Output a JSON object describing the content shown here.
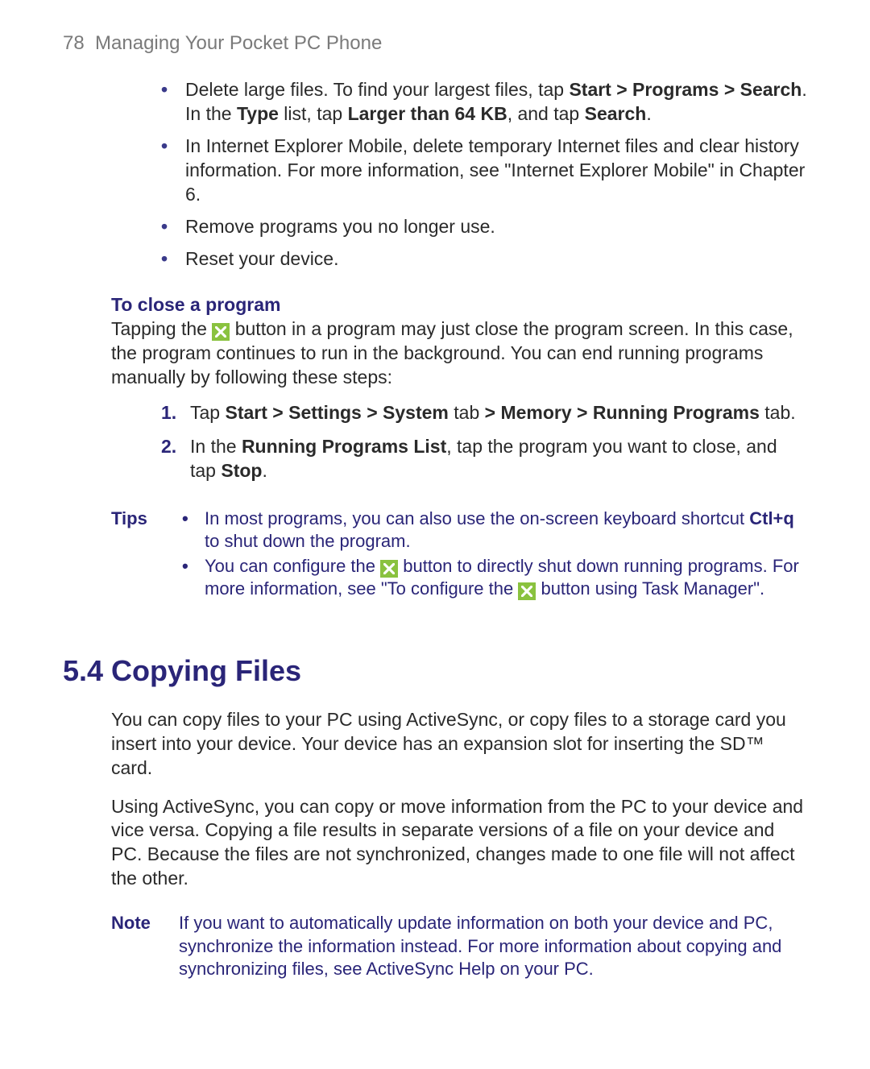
{
  "header": {
    "page_number": "78",
    "chapter_title": "Managing Your Pocket PC Phone"
  },
  "bullets": {
    "item1_pre": "Delete large files. To find your largest files, tap ",
    "item1_b1": "Start > Programs > Search",
    "item1_mid1": ". In the ",
    "item1_b2": "Type",
    "item1_mid2": " list, tap ",
    "item1_b3": "Larger than 64 KB",
    "item1_mid3": ", and tap ",
    "item1_b4": "Search",
    "item1_end": ".",
    "item2": "In Internet Explorer Mobile, delete temporary Internet files and clear history information. For more information, see \"Internet Explorer Mobile\" in Chapter 6.",
    "item3": "Remove programs you no longer use.",
    "item4": "Reset your device."
  },
  "close_prog": {
    "heading": "To close a program",
    "para_pre": "Tapping the ",
    "para_post": " button in a program may just close the program screen. In this case, the program continues to run in the background. You can end running programs manually by following these steps:"
  },
  "steps": {
    "n1": "1.",
    "s1_pre": "Tap ",
    "s1_b1": "Start > Settings > System",
    "s1_mid1": " tab ",
    "s1_b2": "> Memory > Running Programs",
    "s1_end": " tab.",
    "n2": "2.",
    "s2_pre": "In the ",
    "s2_b1": "Running Programs List",
    "s2_mid": ", tap the program you want to close, and tap ",
    "s2_b2": "Stop",
    "s2_end": "."
  },
  "tips": {
    "label": "Tips",
    "t1_pre": "In most programs, you can also use the on-screen keyboard shortcut ",
    "t1_b": "Ctl+q",
    "t1_post": " to shut down the program.",
    "t2_pre": "You can configure the ",
    "t2_mid": " button to directly shut down running programs. For more information, see \"To configure the ",
    "t2_post": " button using Task Manager\"."
  },
  "section54": {
    "heading": "5.4 Copying Files",
    "p1": "You can copy files to your PC using ActiveSync, or copy files to a storage card you insert into your device. Your device has an expansion slot for inserting the SD™ card.",
    "p2": "Using ActiveSync, you can copy or move information from the PC to your device and vice versa. Copying a file results in separate versions of a file on your device and PC. Because the files are not synchronized, changes made to one file will not affect the other."
  },
  "note": {
    "label": "Note",
    "text": "If you want to automatically update information on both your device and PC, synchronize the information instead. For more information about copying and synchronizing files, see ActiveSync Help on your PC."
  }
}
